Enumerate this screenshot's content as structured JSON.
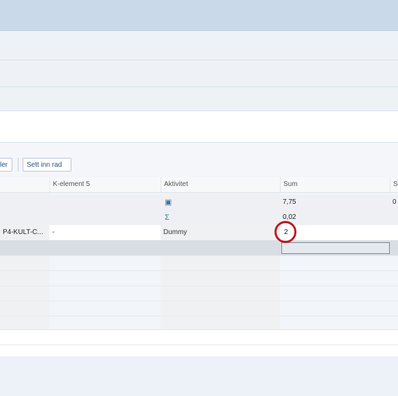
{
  "toolbar": {
    "partial_button_label": "ler",
    "insert_row_label": "Sett inn rad"
  },
  "grid": {
    "columns": [
      "K-element 5",
      "Aktivitet",
      "Sum",
      "S"
    ],
    "rows": [
      {
        "first": "",
        "k_element_5": "",
        "aktivitet_icon": "calendar-icon",
        "sum": "7,75",
        "s": "0"
      },
      {
        "first": "",
        "k_element_5": "",
        "aktivitet_icon": "sigma-icon",
        "sum": "0,02",
        "s": ""
      },
      {
        "first": "P4-KULT-C...",
        "k_element_5": "-",
        "aktivitet": "Dummy",
        "sum": "2",
        "s": ""
      }
    ]
  },
  "icons": {
    "calendar": "▣",
    "sigma": "Σ"
  },
  "colors": {
    "highlight_circle": "#c0161b",
    "topbar": "#c9d9ea"
  }
}
